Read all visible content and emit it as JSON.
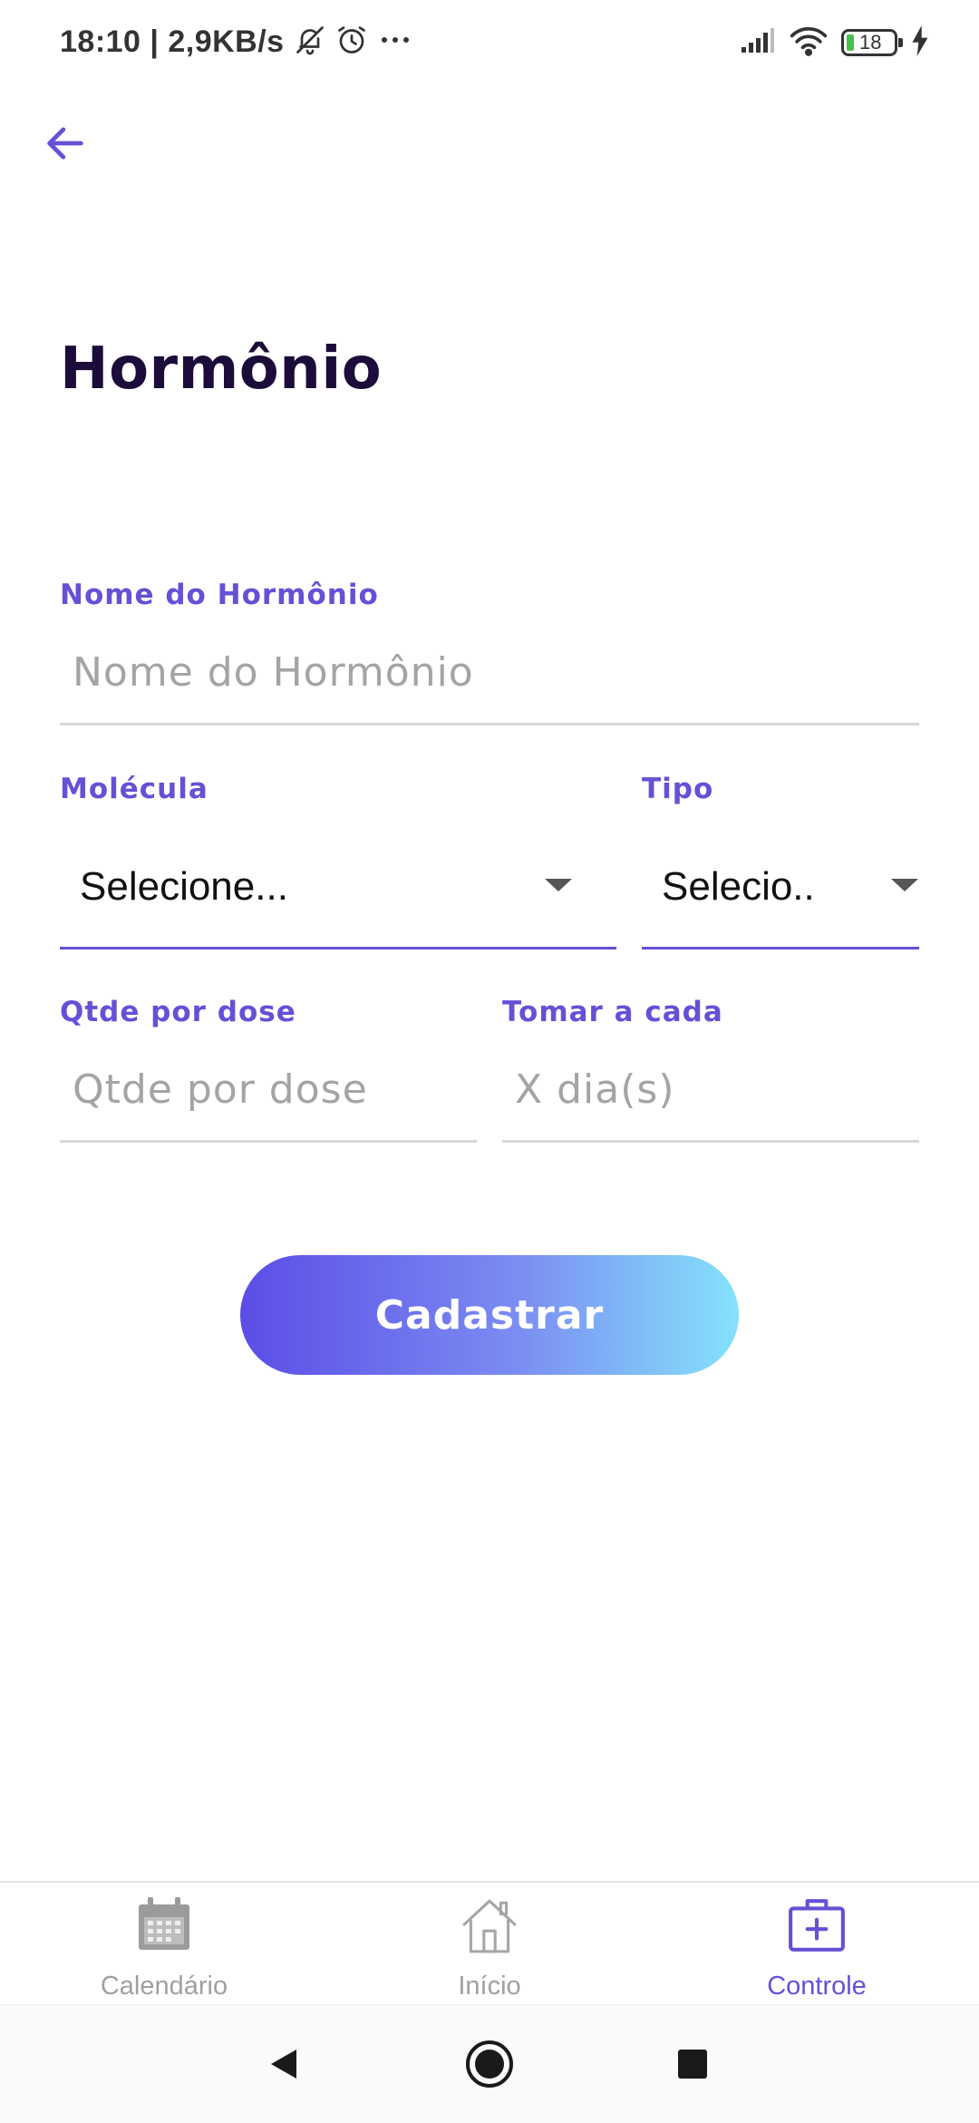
{
  "status_bar": {
    "time": "18:10 | 2,9KB/s",
    "icons": [
      "bell-off-icon",
      "alarm-icon",
      "more-icon",
      "signal-icon",
      "wifi-icon",
      "battery-icon",
      "charging-icon"
    ],
    "battery_level": "18"
  },
  "header": {
    "back_icon": "arrow-left-icon",
    "title": "Hormônio"
  },
  "form": {
    "nome": {
      "label": "Nome do Hormônio",
      "placeholder": "Nome do Hormônio",
      "value": ""
    },
    "molecula": {
      "label": "Molécula",
      "selected": "Selecione..."
    },
    "tipo": {
      "label": "Tipo",
      "selected": "Selecio.."
    },
    "qtde": {
      "label": "Qtde por dose",
      "placeholder": "Qtde por dose",
      "value": ""
    },
    "tomar": {
      "label": "Tomar a cada",
      "placeholder": "X dia(s)",
      "value": ""
    },
    "submit_label": "Cadastrar"
  },
  "bottom_nav": {
    "items": [
      {
        "label": "Calendário",
        "icon": "calendar-icon",
        "active": false
      },
      {
        "label": "Início",
        "icon": "home-icon",
        "active": false
      },
      {
        "label": "Controle",
        "icon": "medical-kit-icon",
        "active": true
      }
    ]
  },
  "system_nav": [
    "back-triangle-icon",
    "home-circle-icon",
    "recents-square-icon"
  ],
  "colors": {
    "accent": "#6650d6",
    "title": "#1b0c3a",
    "gradient_start": "#5b4de6",
    "gradient_end": "#84e2fb",
    "inactive": "#a0a0a0",
    "battery_fill": "#46c14b"
  }
}
